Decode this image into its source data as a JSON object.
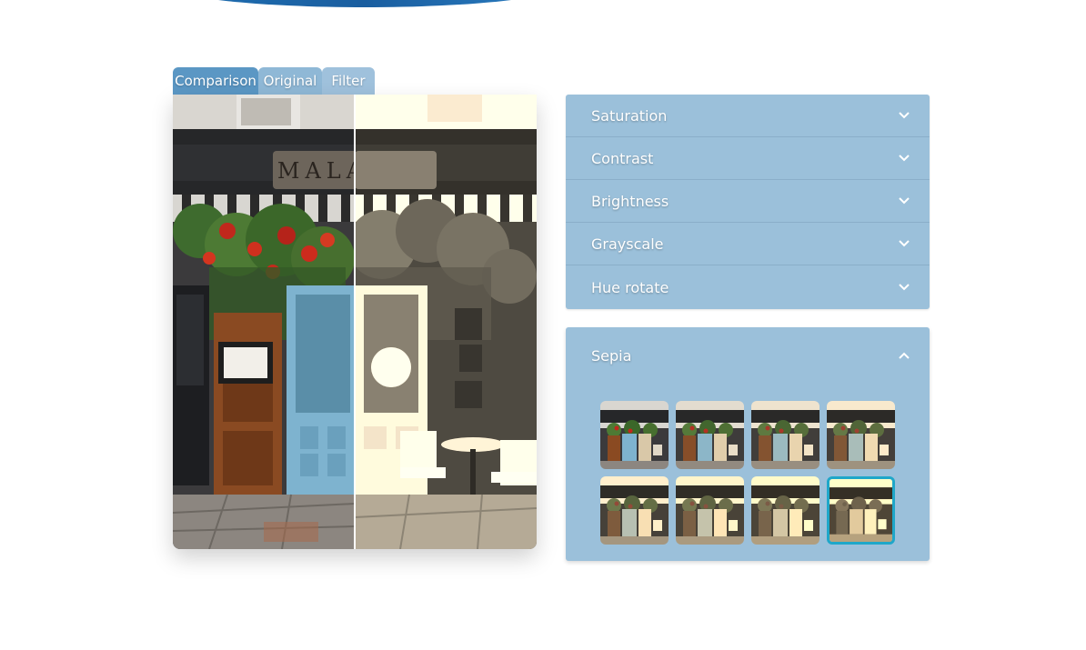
{
  "tabs": [
    {
      "label": "Comparison",
      "active": true
    },
    {
      "label": "Original",
      "active": false
    },
    {
      "label": "Filter",
      "active": false
    }
  ],
  "viewer": {
    "sign_text": "MALABAR",
    "split_percent": 50
  },
  "accordion": {
    "items": [
      {
        "label": "Saturation",
        "icon": "chevron-down-icon",
        "expanded": false
      },
      {
        "label": "Contrast",
        "icon": "chevron-down-icon",
        "expanded": false
      },
      {
        "label": "Brightness",
        "icon": "chevron-down-icon",
        "expanded": false
      },
      {
        "label": "Grayscale",
        "icon": "chevron-down-icon",
        "expanded": false
      },
      {
        "label": "Hue rotate",
        "icon": "chevron-down-icon",
        "expanded": false
      }
    ]
  },
  "sepia": {
    "label": "Sepia",
    "icon": "chevron-up-icon",
    "expanded": true,
    "presets_count": 8,
    "selected_index": 7
  },
  "colors": {
    "accent": "#5b97c4",
    "panel": "#9bc0da",
    "selected_border": "#1fa7c9",
    "door_blue": "#7eb3cf",
    "door_wood": "#8a4a22",
    "flowers_red": "#c0281c"
  }
}
